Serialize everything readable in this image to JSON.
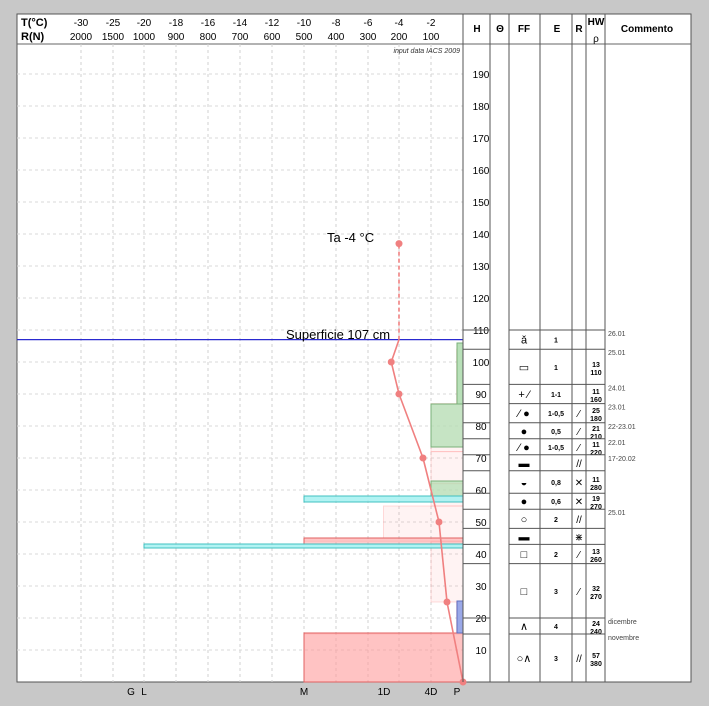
{
  "header": {
    "t_label": "T(°C)",
    "r_label": "R(N)",
    "t_ticks": [
      "-30",
      "-25",
      "-20",
      "-18",
      "-16",
      "-14",
      "-12",
      "-10",
      "-8",
      "-6",
      "-4",
      "-2"
    ],
    "r_ticks": [
      "2000",
      "1500",
      "1000",
      "900",
      "800",
      "700",
      "600",
      "500",
      "400",
      "300",
      "200",
      "100"
    ],
    "source_note": "input data IACS 2009"
  },
  "columns": {
    "h": "H",
    "theta": "Θ",
    "ff": "FF",
    "e": "E",
    "r": "R",
    "hw": "HW",
    "rho": "ρ",
    "commento": "Commento"
  },
  "hardness_axis": [
    "G",
    "L",
    "M",
    "1D",
    "4D",
    "P"
  ],
  "annotations": {
    "air_temp": "Ta  -4 °C",
    "surface": "Superficie  107 cm"
  },
  "colors": {
    "temperature": "#f08080",
    "ram": "#ff9a9a",
    "surface_line": "#2a2ad0",
    "cyan": "#9ff0f0",
    "green": "#b8e0b8",
    "blue_layer": "#9aa8e8"
  },
  "layers": [
    {
      "top": "110",
      "bottom": "104",
      "ff": "ǎ",
      "e": "1",
      "hw": "",
      "rho": "",
      "r": "",
      "comment": "26.01"
    },
    {
      "top": "104",
      "bottom": "93",
      "ff": "▭",
      "e": "1",
      "hw": "13",
      "rho": "110",
      "r": "",
      "comment": "25.01"
    },
    {
      "top": "93",
      "bottom": "87",
      "ff": "+ ⁄",
      "e": "1-1",
      "hw": "11",
      "rho": "160",
      "r": "",
      "comment": "24.01"
    },
    {
      "top": "87",
      "bottom": "81",
      "ff": "⁄ ●",
      "e": "1-0,5",
      "hw": "25",
      "rho": "180",
      "r": "⁄",
      "comment": "23.01"
    },
    {
      "top": "81",
      "bottom": "76",
      "ff": "●",
      "e": "0,5",
      "hw": "21",
      "rho": "210",
      "r": "⁄",
      "comment": "22-23.01"
    },
    {
      "top": "76",
      "bottom": "71",
      "ff": "⁄ ●",
      "e": "1-0,5",
      "hw": "11",
      "rho": "220",
      "r": "⁄",
      "comment": "22.01"
    },
    {
      "top": "71",
      "bottom": "66",
      "ff": "▬",
      "e": "",
      "hw": "",
      "rho": "",
      "r": "//",
      "comment": "17-20.02"
    },
    {
      "top": "66",
      "bottom": "59",
      "ff": "◒",
      "e": "0,8",
      "hw": "11",
      "rho": "280",
      "r": "✕",
      "comment": ""
    },
    {
      "top": "59",
      "bottom": "54",
      "ff": "●",
      "e": "0,6",
      "hw": "19",
      "rho": "270",
      "r": "✕",
      "comment": ""
    },
    {
      "top": "54",
      "bottom": "48",
      "ff": "○",
      "e": "2",
      "hw": "",
      "rho": "",
      "r": "//",
      "comment": "25.01"
    },
    {
      "top": "48",
      "bottom": "43",
      "ff": "▬",
      "e": "",
      "hw": "",
      "rho": "",
      "r": "⋇",
      "comment": ""
    },
    {
      "top": "43",
      "bottom": "37",
      "ff": "□",
      "e": "2",
      "hw": "13",
      "rho": "260",
      "r": "⁄",
      "comment": ""
    },
    {
      "top": "37",
      "bottom": "20",
      "ff": "□",
      "e": "3",
      "hw": "32",
      "rho": "270",
      "r": "⁄",
      "comment": ""
    },
    {
      "top": "20",
      "bottom": "15",
      "ff": "∧",
      "e": "4",
      "hw": "24",
      "rho": "240",
      "r": "",
      "comment": "dicembre"
    },
    {
      "top": "15",
      "bottom": "0",
      "ff": "○∧",
      "e": "3",
      "hw": "57",
      "rho": "380",
      "r": "//",
      "comment": "novembre"
    }
  ],
  "chart_data": {
    "type": "line",
    "title": "",
    "xlabel": "T(°C)",
    "ylabel": "H",
    "ylim": [
      0,
      200
    ],
    "y_ticks": [
      10,
      20,
      30,
      40,
      50,
      60,
      70,
      80,
      90,
      100,
      110,
      120,
      130,
      140,
      150,
      160,
      170,
      180,
      190
    ],
    "snow_height_cm": 107,
    "air_temperature_c": -4,
    "series": [
      {
        "name": "",
        "x": [
          0,
          -1,
          -1.5,
          -2.5,
          -4,
          -4.5,
          -4,
          -4
        ],
        "y": [
          0,
          25,
          50,
          70,
          90,
          100,
          107,
          137
        ]
      }
    ],
    "ram_profile": [
      {
        "bottom": 0,
        "top": 15,
        "resistance": 500
      },
      {
        "bottom": 15,
        "top": 25,
        "resistance": 20
      },
      {
        "bottom": 25,
        "top": 44,
        "resistance": 100
      },
      {
        "bottom": 44,
        "top": 45,
        "resistance": 500
      },
      {
        "bottom": 45,
        "top": 55,
        "resistance": 250
      },
      {
        "bottom": 55,
        "top": 62,
        "resistance": 100
      },
      {
        "bottom": 62,
        "top": 72,
        "resistance": 100
      },
      {
        "bottom": 72,
        "top": 87,
        "resistance": 100
      },
      {
        "bottom": 87,
        "top": 104,
        "resistance": 20
      }
    ]
  }
}
